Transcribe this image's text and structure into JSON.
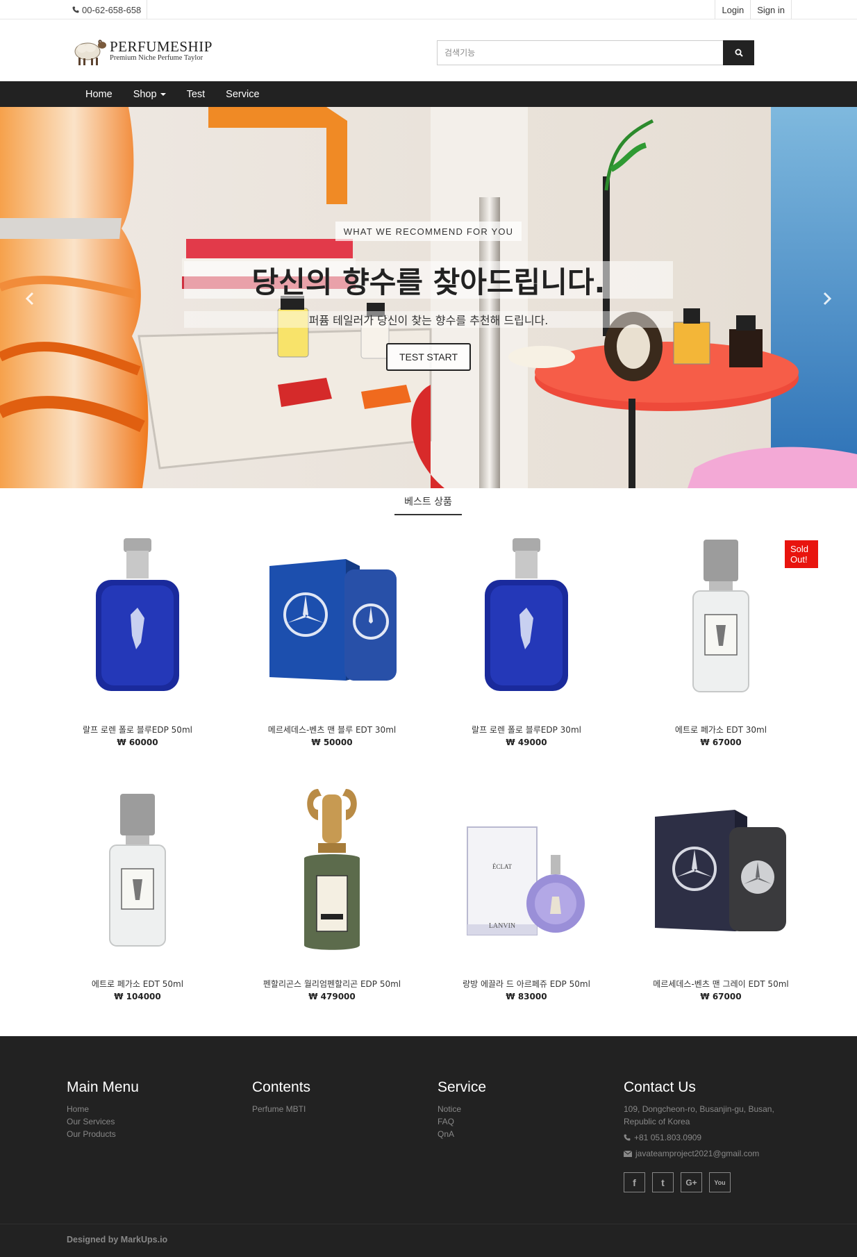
{
  "topbar": {
    "phone": "00-62-658-658",
    "login": "Login",
    "signin": "Sign in"
  },
  "header": {
    "brand_name": "PERFUMESHIP",
    "brand_tagline": "Premium Niche Perfume Taylor",
    "search_placeholder": "검색기능"
  },
  "nav": {
    "home": "Home",
    "shop": "Shop",
    "test": "Test",
    "service": "Service"
  },
  "hero": {
    "eyebrow": "WHAT WE RECOMMEND FOR YOU",
    "headline": "당신의 향수를 찾아드립니다.",
    "subheadline": "퍼퓸 테일러가 당신이 찾는 향수를 추천해 드립니다.",
    "cta": "TEST START"
  },
  "best": {
    "title": "베스트 상품",
    "sold_out_label": "Sold Out!",
    "products": [
      {
        "name": "랄프 로렌 폴로 블루EDP 50ml",
        "price": "₩ 60000",
        "icon": "polo-blue-bottle"
      },
      {
        "name": "메르세데스-벤츠 맨 블루 EDT 30ml",
        "price": "₩ 50000",
        "icon": "mercedes-blue-box"
      },
      {
        "name": "랄프 로렌 폴로 블루EDP 30ml",
        "price": "₩ 49000",
        "icon": "polo-blue-bottle"
      },
      {
        "name": "에트로 페가소 EDT 30ml",
        "price": "₩ 67000",
        "icon": "etro-pegaso-bottle",
        "sold_out": true
      },
      {
        "name": "에트로 페가소 EDT 50ml",
        "price": "₩ 104000",
        "icon": "etro-pegaso-bottle"
      },
      {
        "name": "펜할리곤스 월리엄펜할리곤 EDP 50ml",
        "price": "₩ 479000",
        "icon": "penhaligons-ram-bottle"
      },
      {
        "name": "랑방 에끌라 드 아르페쥬 EDP 50ml",
        "price": "₩ 83000",
        "icon": "lanvin-eclat-bottle"
      },
      {
        "name": "메르세데스-벤츠 맨 그레이 EDT 50ml",
        "price": "₩ 67000",
        "icon": "mercedes-grey-box"
      }
    ]
  },
  "footer": {
    "main_menu": {
      "title": "Main Menu",
      "links": [
        "Home",
        "Our Services",
        "Our Products"
      ]
    },
    "contents": {
      "title": "Contents",
      "links": [
        "Perfume MBTI"
      ]
    },
    "service": {
      "title": "Service",
      "links": [
        "Notice",
        "FAQ",
        "QnA"
      ]
    },
    "contact": {
      "title": "Contact Us",
      "address": "109, Dongcheon-ro, Busanjin-gu, Busan, Republic of Korea",
      "phone": "+81 051.803.0909",
      "email": "javateamproject2021@gmail.com"
    },
    "social": {
      "facebook": "f",
      "twitter": "t",
      "google": "G+",
      "youtube": "You"
    },
    "credit": "Designed by MarkUps.io"
  },
  "colors": {
    "nav_bg": "#222222",
    "footer_bg": "#222222",
    "sold_out": "#e8140e",
    "polo_blue": "#1a2a9c"
  }
}
